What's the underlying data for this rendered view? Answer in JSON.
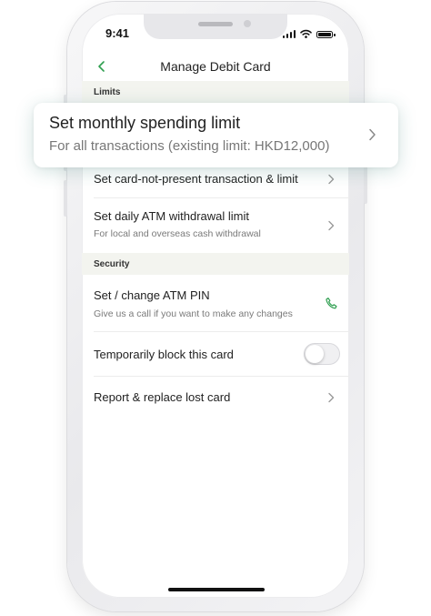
{
  "status_bar": {
    "time": "9:41"
  },
  "header": {
    "title": "Manage Debit Card"
  },
  "sections": [
    {
      "title": "Limits"
    },
    {
      "title": "Security"
    }
  ],
  "limits": {
    "monthly": {
      "title": "Set monthly spending limit",
      "subtitle": "For all transactions (existing limit: HKD12,000)"
    },
    "cnp": {
      "title": "Set card-not-present transaction & limit"
    },
    "atm_daily": {
      "title": "Set daily ATM withdrawal limit",
      "subtitle": "For local and overseas cash withdrawal"
    }
  },
  "security": {
    "pin": {
      "title": "Set / change ATM PIN",
      "subtitle": "Give us a call if you want to make any changes"
    },
    "block": {
      "title": "Temporarily block this card",
      "enabled": false
    },
    "report": {
      "title": "Report & replace lost card"
    }
  },
  "icons": {
    "back": "chevron-left-icon",
    "chevron": "chevron-right-icon",
    "phone": "phone-icon"
  },
  "colors": {
    "accent": "#2e9e4f",
    "section_bg": "#f3f4ef"
  }
}
